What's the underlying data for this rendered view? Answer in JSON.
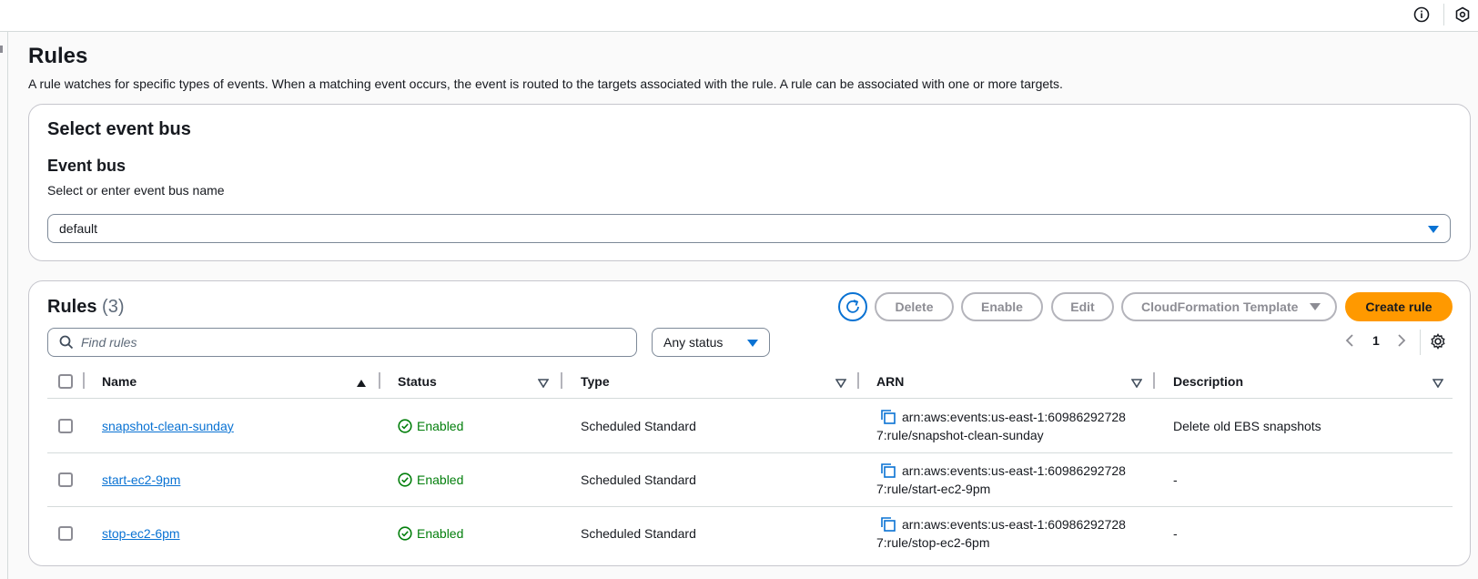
{
  "page": {
    "title": "Rules",
    "description": "A rule watches for specific types of events. When a matching event occurs, the event is routed to the targets associated with the rule. A rule can be associated with one or more targets."
  },
  "event_bus_card": {
    "title": "Select event bus",
    "field_label": "Event bus",
    "field_hint": "Select or enter event bus name",
    "selected": "default"
  },
  "rules_card": {
    "title": "Rules",
    "count": "(3)",
    "buttons": {
      "delete": "Delete",
      "enable": "Enable",
      "edit": "Edit",
      "cloudformation": "CloudFormation Template",
      "create": "Create rule"
    },
    "search_placeholder": "Find rules",
    "status_filter": "Any status",
    "page_number": "1",
    "columns": [
      "Name",
      "Status",
      "Type",
      "ARN",
      "Description"
    ],
    "rows": [
      {
        "name": "snapshot-clean-sunday",
        "status": "Enabled",
        "type": "Scheduled Standard",
        "arn_line1": "arn:aws:events:us-east-1:60986292728",
        "arn_line2": "7:rule/snapshot-clean-sunday",
        "description": "Delete old EBS snapshots"
      },
      {
        "name": "start-ec2-9pm",
        "status": "Enabled",
        "type": "Scheduled Standard",
        "arn_line1": "arn:aws:events:us-east-1:60986292728",
        "arn_line2": "7:rule/start-ec2-9pm",
        "description": "-"
      },
      {
        "name": "stop-ec2-6pm",
        "status": "Enabled",
        "type": "Scheduled Standard",
        "arn_line1": "arn:aws:events:us-east-1:60986292728",
        "arn_line2": "7:rule/stop-ec2-6pm",
        "description": "-"
      }
    ]
  },
  "colors": {
    "accent": "#0972d3",
    "primary_button": "#ff9900",
    "success": "#037f0c"
  },
  "icons": [
    "info-icon",
    "settings-hex-icon",
    "refresh-icon",
    "search-icon",
    "chevron-left-icon",
    "chevron-right-icon",
    "gear-icon",
    "copy-icon",
    "check-circle-icon"
  ]
}
